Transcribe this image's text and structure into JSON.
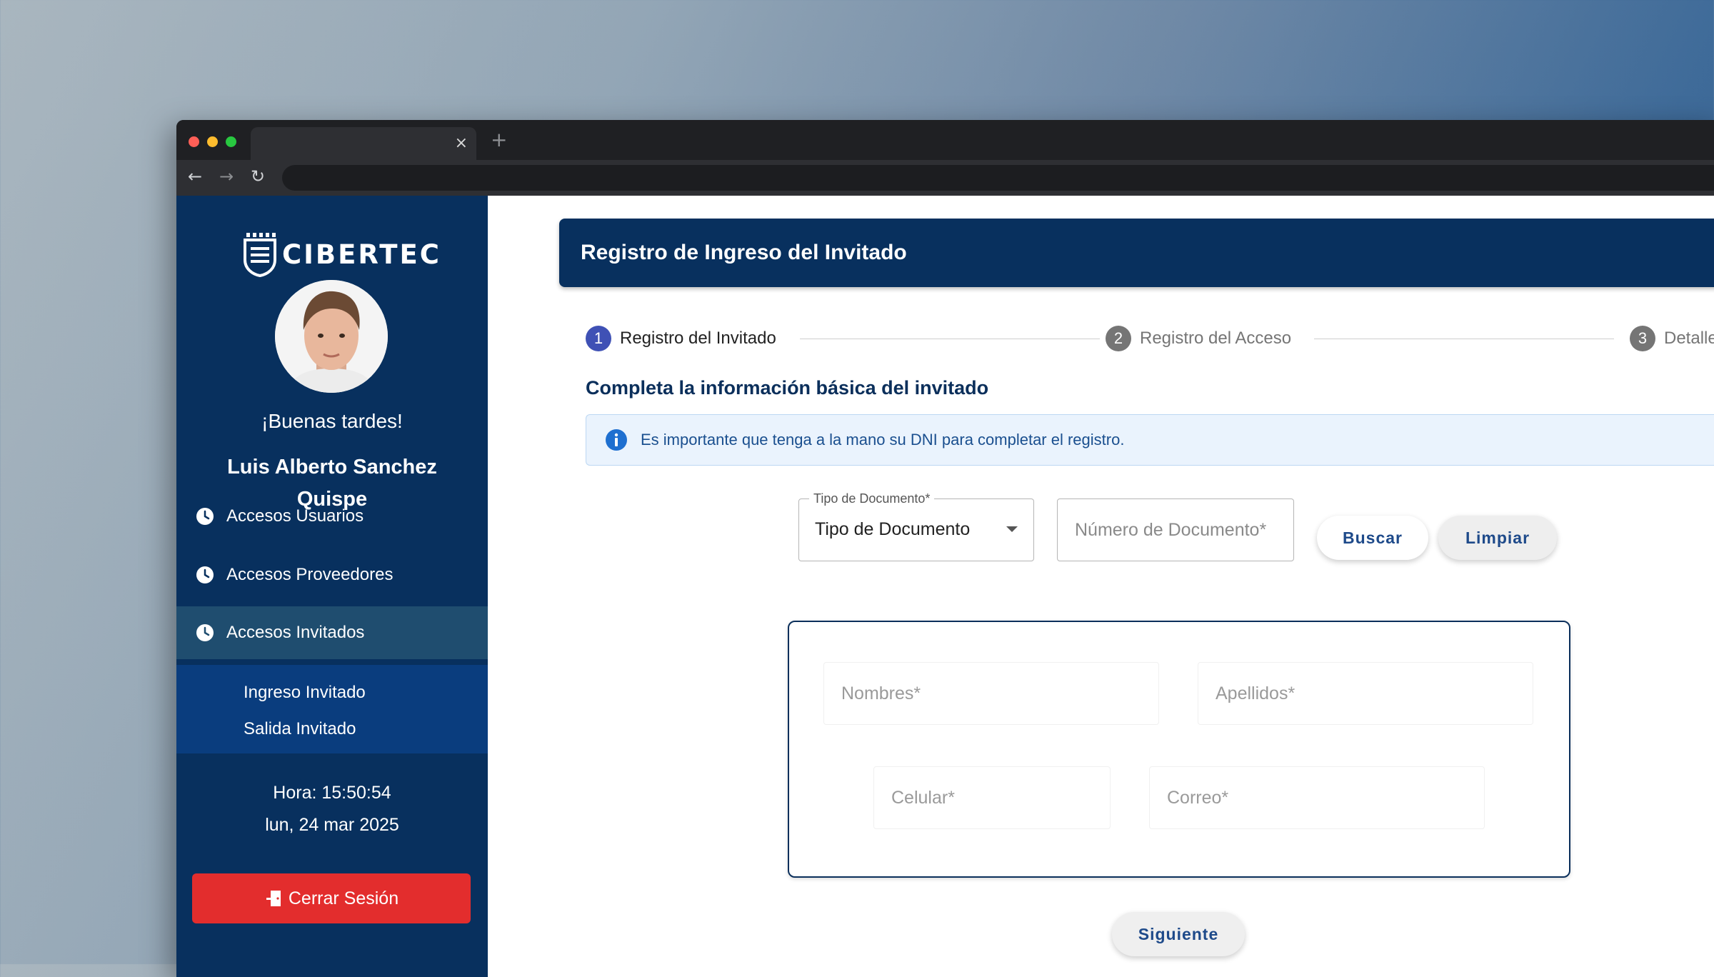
{
  "browser": {
    "tab_close": "×",
    "new_tab": "+",
    "nav": {
      "back": "←",
      "forward": "→",
      "reload": "↻"
    }
  },
  "sidebar": {
    "brand": "CIBERTEC",
    "greeting": "¡Buenas tardes!",
    "user_name": "Luis Alberto Sanchez Quispe",
    "menu": [
      {
        "label": "Accesos Usuarios",
        "icon": "clock-icon"
      },
      {
        "label": "Accesos Proveedores",
        "icon": "clock-icon"
      },
      {
        "label": "Accesos Invitados",
        "icon": "clock-icon",
        "active": true
      }
    ],
    "submenu": [
      {
        "label": "Ingreso Invitado"
      },
      {
        "label": "Salida Invitado"
      }
    ],
    "time": "Hora: 15:50:54",
    "date": "lun, 24 mar 2025",
    "logout_label": "Cerrar Sesión"
  },
  "main": {
    "title": "Registro de Ingreso del Invitado",
    "steps": [
      {
        "number": "1",
        "label": "Registro del Invitado",
        "active": true
      },
      {
        "number": "2",
        "label": "Registro del Acceso",
        "active": false
      },
      {
        "number": "3",
        "label": "Detalle del",
        "active": false
      }
    ],
    "section_title": "Completa la información básica del invitado",
    "alert": "Es importante que tenga a la mano su DNI para completar el registro.",
    "document_type": {
      "legend": "Tipo de Documento*",
      "value": "Tipo de Documento"
    },
    "document_number": {
      "placeholder": "Número de Documento*"
    },
    "buttons": {
      "search": "Buscar",
      "clear": "Limpiar",
      "next": "Siguiente"
    },
    "fields": {
      "nombres": "Nombres*",
      "apellidos": "Apellidos*",
      "celular": "Celular*",
      "correo": "Correo*"
    }
  },
  "colors": {
    "navy": "#08305e",
    "active_menu": "#1f4d6f",
    "submenu": "#0a3d7e",
    "logout": "#e32d2d",
    "step_active": "#3f51b5",
    "step_inactive": "#757575",
    "alert_bg": "#eaf3fd"
  }
}
